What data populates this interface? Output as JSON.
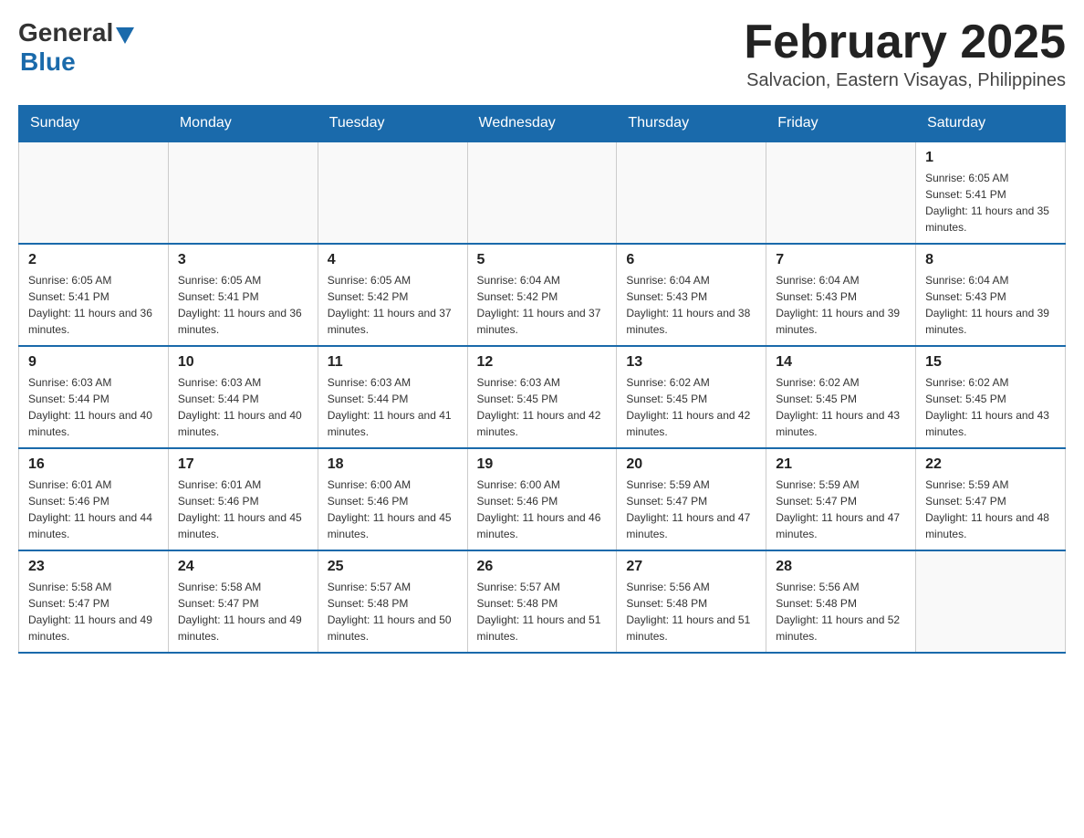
{
  "header": {
    "logo_text_general": "General",
    "logo_text_blue": "Blue",
    "month_title": "February 2025",
    "location": "Salvacion, Eastern Visayas, Philippines"
  },
  "days_of_week": [
    "Sunday",
    "Monday",
    "Tuesday",
    "Wednesday",
    "Thursday",
    "Friday",
    "Saturday"
  ],
  "weeks": [
    [
      {
        "day": "",
        "sunrise": "",
        "sunset": "",
        "daylight": ""
      },
      {
        "day": "",
        "sunrise": "",
        "sunset": "",
        "daylight": ""
      },
      {
        "day": "",
        "sunrise": "",
        "sunset": "",
        "daylight": ""
      },
      {
        "day": "",
        "sunrise": "",
        "sunset": "",
        "daylight": ""
      },
      {
        "day": "",
        "sunrise": "",
        "sunset": "",
        "daylight": ""
      },
      {
        "day": "",
        "sunrise": "",
        "sunset": "",
        "daylight": ""
      },
      {
        "day": "1",
        "sunrise": "Sunrise: 6:05 AM",
        "sunset": "Sunset: 5:41 PM",
        "daylight": "Daylight: 11 hours and 35 minutes."
      }
    ],
    [
      {
        "day": "2",
        "sunrise": "Sunrise: 6:05 AM",
        "sunset": "Sunset: 5:41 PM",
        "daylight": "Daylight: 11 hours and 36 minutes."
      },
      {
        "day": "3",
        "sunrise": "Sunrise: 6:05 AM",
        "sunset": "Sunset: 5:41 PM",
        "daylight": "Daylight: 11 hours and 36 minutes."
      },
      {
        "day": "4",
        "sunrise": "Sunrise: 6:05 AM",
        "sunset": "Sunset: 5:42 PM",
        "daylight": "Daylight: 11 hours and 37 minutes."
      },
      {
        "day": "5",
        "sunrise": "Sunrise: 6:04 AM",
        "sunset": "Sunset: 5:42 PM",
        "daylight": "Daylight: 11 hours and 37 minutes."
      },
      {
        "day": "6",
        "sunrise": "Sunrise: 6:04 AM",
        "sunset": "Sunset: 5:43 PM",
        "daylight": "Daylight: 11 hours and 38 minutes."
      },
      {
        "day": "7",
        "sunrise": "Sunrise: 6:04 AM",
        "sunset": "Sunset: 5:43 PM",
        "daylight": "Daylight: 11 hours and 39 minutes."
      },
      {
        "day": "8",
        "sunrise": "Sunrise: 6:04 AM",
        "sunset": "Sunset: 5:43 PM",
        "daylight": "Daylight: 11 hours and 39 minutes."
      }
    ],
    [
      {
        "day": "9",
        "sunrise": "Sunrise: 6:03 AM",
        "sunset": "Sunset: 5:44 PM",
        "daylight": "Daylight: 11 hours and 40 minutes."
      },
      {
        "day": "10",
        "sunrise": "Sunrise: 6:03 AM",
        "sunset": "Sunset: 5:44 PM",
        "daylight": "Daylight: 11 hours and 40 minutes."
      },
      {
        "day": "11",
        "sunrise": "Sunrise: 6:03 AM",
        "sunset": "Sunset: 5:44 PM",
        "daylight": "Daylight: 11 hours and 41 minutes."
      },
      {
        "day": "12",
        "sunrise": "Sunrise: 6:03 AM",
        "sunset": "Sunset: 5:45 PM",
        "daylight": "Daylight: 11 hours and 42 minutes."
      },
      {
        "day": "13",
        "sunrise": "Sunrise: 6:02 AM",
        "sunset": "Sunset: 5:45 PM",
        "daylight": "Daylight: 11 hours and 42 minutes."
      },
      {
        "day": "14",
        "sunrise": "Sunrise: 6:02 AM",
        "sunset": "Sunset: 5:45 PM",
        "daylight": "Daylight: 11 hours and 43 minutes."
      },
      {
        "day": "15",
        "sunrise": "Sunrise: 6:02 AM",
        "sunset": "Sunset: 5:45 PM",
        "daylight": "Daylight: 11 hours and 43 minutes."
      }
    ],
    [
      {
        "day": "16",
        "sunrise": "Sunrise: 6:01 AM",
        "sunset": "Sunset: 5:46 PM",
        "daylight": "Daylight: 11 hours and 44 minutes."
      },
      {
        "day": "17",
        "sunrise": "Sunrise: 6:01 AM",
        "sunset": "Sunset: 5:46 PM",
        "daylight": "Daylight: 11 hours and 45 minutes."
      },
      {
        "day": "18",
        "sunrise": "Sunrise: 6:00 AM",
        "sunset": "Sunset: 5:46 PM",
        "daylight": "Daylight: 11 hours and 45 minutes."
      },
      {
        "day": "19",
        "sunrise": "Sunrise: 6:00 AM",
        "sunset": "Sunset: 5:46 PM",
        "daylight": "Daylight: 11 hours and 46 minutes."
      },
      {
        "day": "20",
        "sunrise": "Sunrise: 5:59 AM",
        "sunset": "Sunset: 5:47 PM",
        "daylight": "Daylight: 11 hours and 47 minutes."
      },
      {
        "day": "21",
        "sunrise": "Sunrise: 5:59 AM",
        "sunset": "Sunset: 5:47 PM",
        "daylight": "Daylight: 11 hours and 47 minutes."
      },
      {
        "day": "22",
        "sunrise": "Sunrise: 5:59 AM",
        "sunset": "Sunset: 5:47 PM",
        "daylight": "Daylight: 11 hours and 48 minutes."
      }
    ],
    [
      {
        "day": "23",
        "sunrise": "Sunrise: 5:58 AM",
        "sunset": "Sunset: 5:47 PM",
        "daylight": "Daylight: 11 hours and 49 minutes."
      },
      {
        "day": "24",
        "sunrise": "Sunrise: 5:58 AM",
        "sunset": "Sunset: 5:47 PM",
        "daylight": "Daylight: 11 hours and 49 minutes."
      },
      {
        "day": "25",
        "sunrise": "Sunrise: 5:57 AM",
        "sunset": "Sunset: 5:48 PM",
        "daylight": "Daylight: 11 hours and 50 minutes."
      },
      {
        "day": "26",
        "sunrise": "Sunrise: 5:57 AM",
        "sunset": "Sunset: 5:48 PM",
        "daylight": "Daylight: 11 hours and 51 minutes."
      },
      {
        "day": "27",
        "sunrise": "Sunrise: 5:56 AM",
        "sunset": "Sunset: 5:48 PM",
        "daylight": "Daylight: 11 hours and 51 minutes."
      },
      {
        "day": "28",
        "sunrise": "Sunrise: 5:56 AM",
        "sunset": "Sunset: 5:48 PM",
        "daylight": "Daylight: 11 hours and 52 minutes."
      },
      {
        "day": "",
        "sunrise": "",
        "sunset": "",
        "daylight": ""
      }
    ]
  ]
}
